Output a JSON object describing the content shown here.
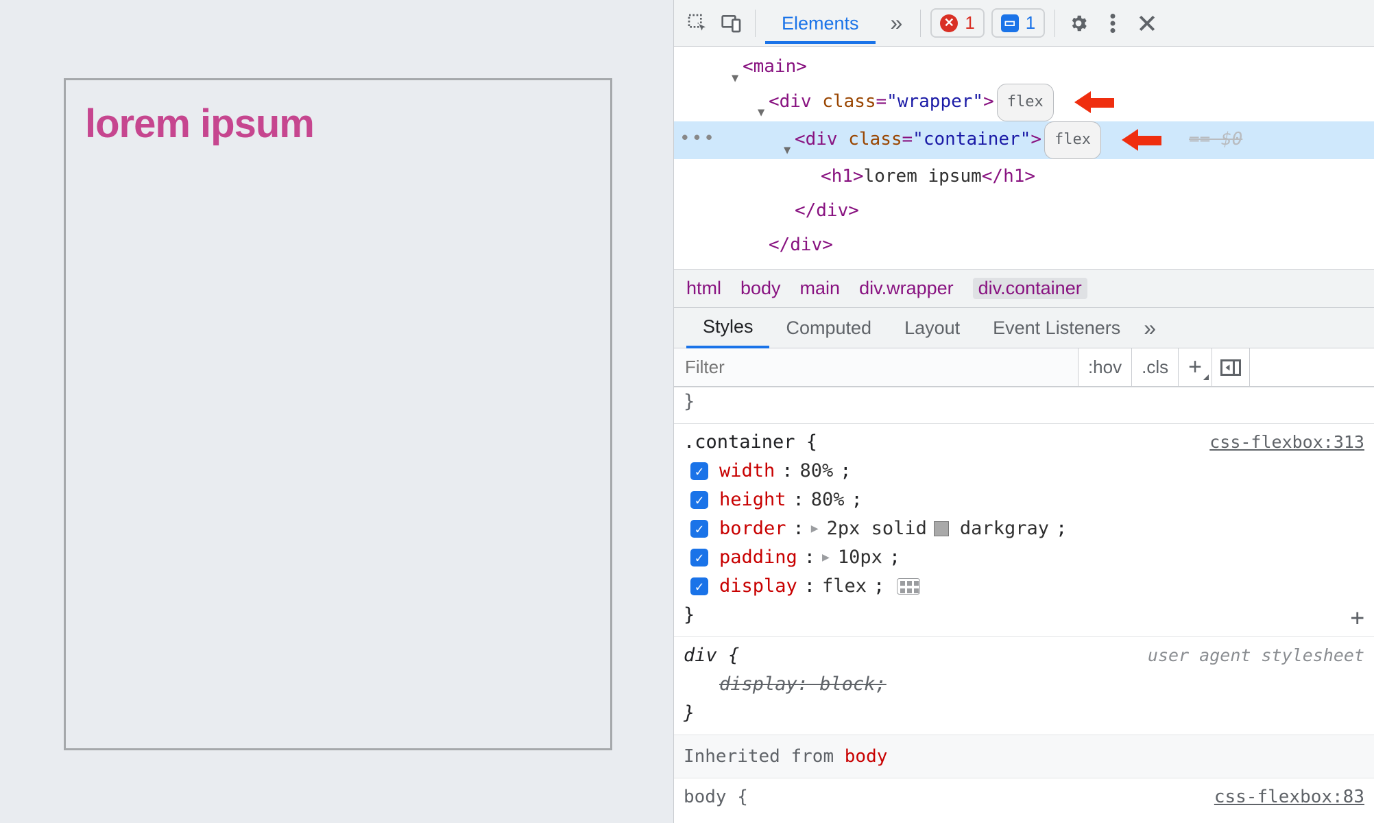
{
  "page": {
    "heading": "lorem ipsum"
  },
  "toolbar": {
    "tabs": {
      "elements": "Elements"
    },
    "more": "»",
    "errors": {
      "count": "1"
    },
    "messages": {
      "count": "1"
    }
  },
  "dom": {
    "main_open": "<main>",
    "wrapper_open_pre": "<div ",
    "wrapper_attr_name": "class",
    "wrapper_attr_eq": "=",
    "wrapper_attr_val": "\"wrapper\"",
    "wrapper_open_post": ">",
    "container_open_pre": "<div ",
    "container_attr_name": "class",
    "container_attr_eq": "=",
    "container_attr_val": "\"container\"",
    "container_open_post": ">",
    "flex_badge": "flex",
    "sel_ghost": "== $0",
    "h1_open": "<h1>",
    "h1_text": "lorem ipsum",
    "h1_close": "</h1>",
    "div_close1": "</div>",
    "div_close2": "</div>"
  },
  "breadcrumb": {
    "items": [
      "html",
      "body",
      "main",
      "div.wrapper",
      "div.container"
    ]
  },
  "stylesTabs": {
    "styles": "Styles",
    "computed": "Computed",
    "layout": "Layout",
    "events": "Event Listeners",
    "more": "»"
  },
  "stylesToolbar": {
    "filter_placeholder": "Filter",
    "hov": ":hov",
    "cls": ".cls",
    "plus": "+"
  },
  "rules": {
    "container": {
      "selector": ".container {",
      "source": "css-flexbox:313",
      "decls": [
        {
          "prop": "width",
          "val": "80%"
        },
        {
          "prop": "height",
          "val": "80%"
        },
        {
          "prop": "border",
          "val_pre": "2px solid ",
          "val_color": "darkgray"
        },
        {
          "prop": "padding",
          "val": "10px"
        },
        {
          "prop": "display",
          "val": "flex"
        }
      ],
      "close": "}"
    },
    "div_ua": {
      "selector": "div {",
      "source": "user agent stylesheet",
      "decl_strike": "display: block;",
      "close": "}"
    },
    "inherited_label": "Inherited from ",
    "inherited_from": "body",
    "peek_selector": "body {",
    "peek_source": "css-flexbox:83"
  }
}
